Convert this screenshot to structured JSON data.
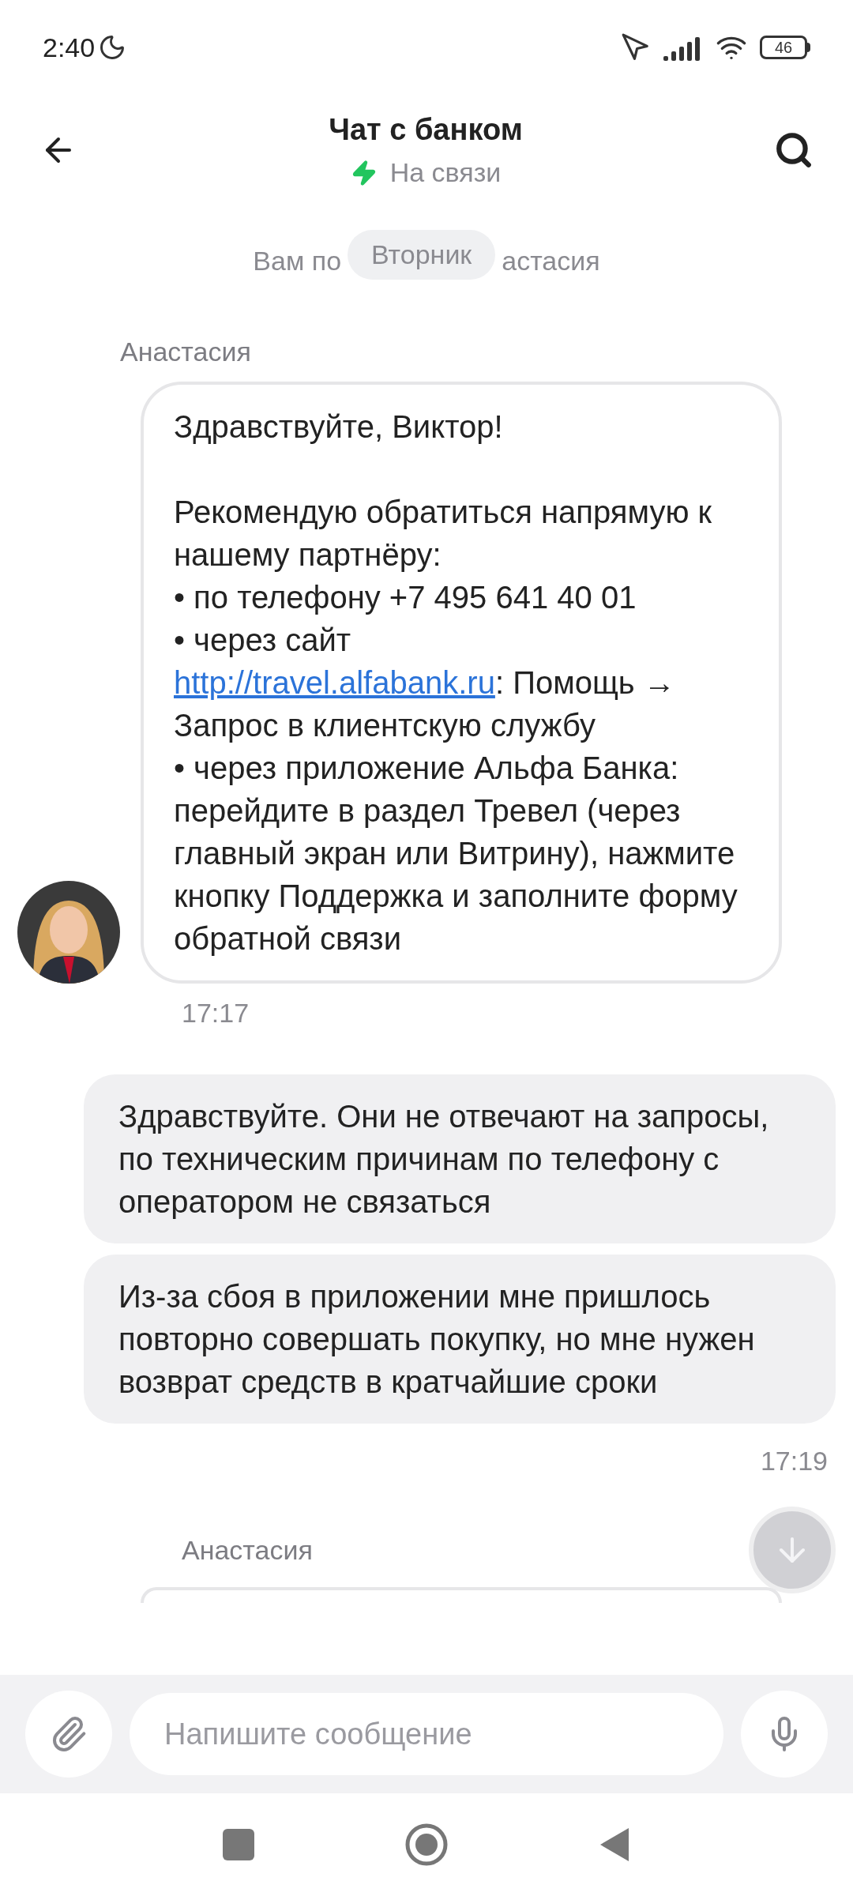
{
  "status_bar": {
    "time": "2:40",
    "battery": "46"
  },
  "header": {
    "title": "Чат с банком",
    "status": "На связи"
  },
  "system_notice": {
    "left_part": "Вам по",
    "date_chip": "Вторник",
    "right_part": "астасия"
  },
  "messages": [
    {
      "kind": "incoming",
      "author": "Анастасия",
      "segments": [
        {
          "kind": "text",
          "text": "Здравствуйте, Виктор!\n\nРекомендую обратиться напрямую к нашему партнёру:\n• по телефону +7 495 641 40 01\n• через сайт\n"
        },
        {
          "kind": "link",
          "text": "http://travel.alfabank.ru"
        },
        {
          "kind": "text",
          "text": ": Помощь → Запрос в клиентскую службу\n• через приложение Альфа Банка: перейдите в раздел Тревел (через главный экран или Витрину), нажмите кнопку Поддержка и заполните форму обратной связи"
        }
      ],
      "time": "17:17"
    },
    {
      "kind": "outgoing",
      "texts": [
        "Здравствуйте. Они не отвечают на запросы, по техническим причинам по телефону с оператором не связаться",
        "Из-за сбоя в приложении мне пришлось повторно совершать покупку, но мне нужен возврат средств в кратчайшие сроки"
      ],
      "time": "17:19"
    },
    {
      "kind": "incoming_partial",
      "author": "Анастасия"
    }
  ],
  "composer": {
    "placeholder": "Напишите сообщение"
  }
}
